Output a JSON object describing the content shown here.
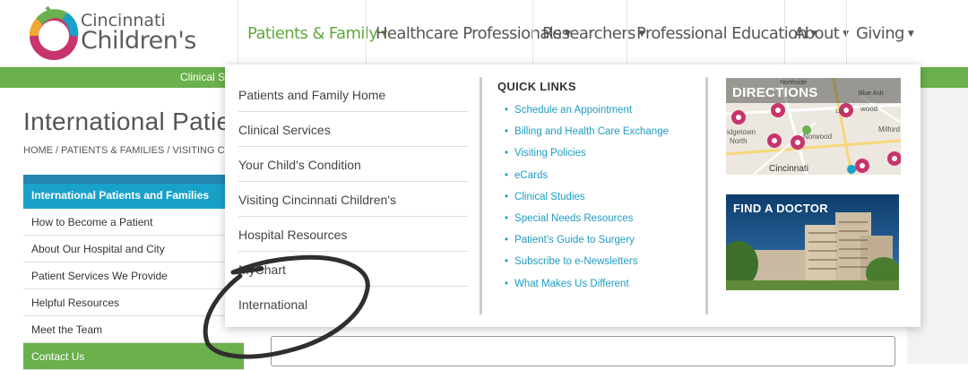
{
  "brand": {
    "line1": "Cincinnati",
    "line2": "Children's"
  },
  "nav": {
    "items": [
      {
        "label": "Patients & Family",
        "active": true
      },
      {
        "label": "Healthcare Professionals"
      },
      {
        "label": "Researchers"
      },
      {
        "label": "Professional Education"
      },
      {
        "label": "About"
      },
      {
        "label": "Giving"
      }
    ]
  },
  "subbar": {
    "text": "Clinical Se"
  },
  "page": {
    "title": "International Patie",
    "breadcrumb": "HOME / PATIENTS & FAMILIES / VISITING C"
  },
  "sidebar": {
    "heading": "International Patients and Families",
    "items": [
      "How to Become a Patient",
      "About Our Hospital and City",
      "Patient Services We Provide",
      "Helpful Resources",
      "Meet the Team",
      "Contact Us"
    ]
  },
  "dropdown": {
    "links": [
      "Patients and Family Home",
      "Clinical Services",
      "Your Child's Condition",
      "Visiting Cincinnati Children's",
      "Hospital Resources",
      "MyChart",
      "International"
    ],
    "quick_links_heading": "QUICK LINKS",
    "quick_links": [
      "Schedule an Appointment",
      "Billing and Health Care Exchange",
      "Visiting Policies",
      "eCards",
      "Clinical Studies",
      "Special Needs Resources",
      "Patient's Guide to Surgery",
      "Subscribe to e-Newsletters",
      "What Makes Us Different"
    ],
    "directions": {
      "label": "DIRECTIONS",
      "map_labels": [
        "Northside",
        "Blue Ash",
        "wood",
        "idgetown",
        "North",
        "Norwood",
        "Milford",
        "Cincinnati"
      ],
      "road_number": "126"
    },
    "find_doctor": {
      "label": "FIND A DOCTOR"
    }
  },
  "colors": {
    "green": "#6ab04c",
    "blue": "#19a2c9",
    "link": "#1e9cc3"
  }
}
